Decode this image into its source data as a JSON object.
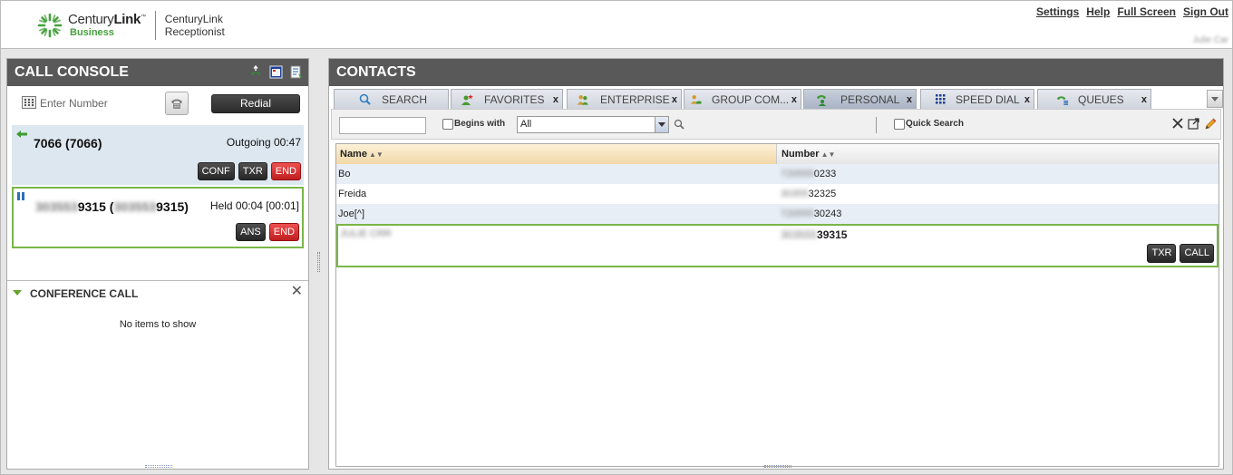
{
  "header": {
    "brand_name_light": "Century",
    "brand_name_bold": "Link",
    "brand_sub": "Business",
    "product_line1": "CenturyLink",
    "product_line2": "Receptionist",
    "links": [
      "Settings",
      "Help",
      "Full Screen",
      "Sign Out"
    ],
    "user_name": "Julie Car"
  },
  "colors": {
    "brand_green": "#46a13c",
    "panel_header": "#595959",
    "selected_border": "#7ab648",
    "end_red": "#d62a2a"
  },
  "call_console": {
    "title": "CALL CONSOLE",
    "dial_placeholder": "Enter Number",
    "redial_label": "Redial",
    "calls": [
      {
        "name": "7066 (7066)",
        "status": "Outgoing 00:47",
        "buttons": [
          "CONF",
          "TXR",
          "END"
        ]
      },
      {
        "name_hidden": "303553",
        "name_visible": "9315 (",
        "name_hidden_2": "303553",
        "name_visible_2": "9315)",
        "status": "Held 00:04 [00:01]",
        "buttons": [
          "ANS",
          "END"
        ]
      }
    ]
  },
  "conference": {
    "title": "CONFERENCE CALL",
    "empty_text": "No items to show"
  },
  "contacts": {
    "title": "CONTACTS",
    "tabs": [
      {
        "label": "SEARCH",
        "icon": "search-icon",
        "closable": false
      },
      {
        "label": "FAVORITES",
        "icon": "favorites-icon",
        "closable": true
      },
      {
        "label": "ENTERPRISE",
        "icon": "enterprise-icon",
        "closable": true
      },
      {
        "label": "GROUP COM...",
        "icon": "group-icon",
        "closable": true
      },
      {
        "label": "PERSONAL",
        "icon": "personal-icon",
        "closable": true,
        "active": true
      },
      {
        "label": "SPEED DIAL",
        "icon": "speed-dial-icon",
        "closable": true
      },
      {
        "label": "QUEUES",
        "icon": "queues-icon",
        "closable": true
      }
    ],
    "close_glyph": "x",
    "search": {
      "value": "",
      "begins_with_label": "Begins with",
      "filter_selected": "All",
      "quick_search_label": "Quick Search"
    },
    "columns": [
      "Name",
      "Number"
    ],
    "rows": [
      {
        "name": "Bo",
        "number_hidden": "720555",
        "number_visible": "0233"
      },
      {
        "name": "Freida",
        "number_hidden": "30355",
        "number_visible": "32325"
      },
      {
        "name": "Joe[^]",
        "number_hidden": "720555",
        "number_visible": "30243"
      }
    ],
    "selected_row": {
      "name_hidden": "JULIE CRR",
      "number_hidden": "303555",
      "number_visible": "39315",
      "buttons": [
        "TXR",
        "CALL"
      ]
    }
  }
}
